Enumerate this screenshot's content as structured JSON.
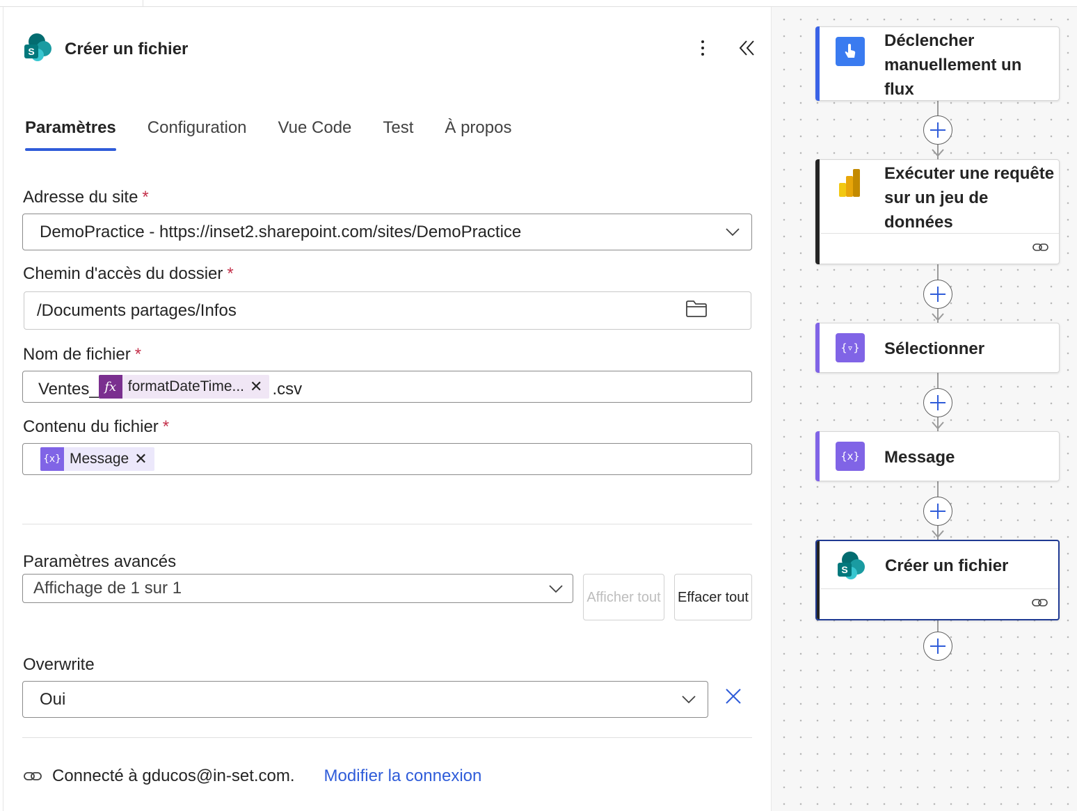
{
  "panel": {
    "title": "Créer un fichier",
    "tabs": [
      {
        "label": "Paramètres",
        "active": true
      },
      {
        "label": "Configuration"
      },
      {
        "label": "Vue Code"
      },
      {
        "label": "Test"
      },
      {
        "label": "À propos"
      }
    ],
    "site_address": {
      "label": "Adresse du site",
      "required": "*",
      "value": "DemoPractice - https://inset2.sharepoint.com/sites/DemoPractice"
    },
    "folder_path": {
      "label": "Chemin d'accès du dossier",
      "required": "*",
      "value": "/Documents partages/Infos"
    },
    "file_name": {
      "label": "Nom de fichier",
      "required": "*",
      "prefix": "Ventes_",
      "token": "formatDateTime...",
      "token_icon": "fx",
      "suffix": ".csv"
    },
    "file_content": {
      "label": "Contenu du fichier",
      "required": "*",
      "token": "Message"
    },
    "advanced": {
      "label": "Paramètres avancés",
      "value": "Affichage de 1 sur 1",
      "show_all": "Afficher tout",
      "clear_all": "Effacer tout"
    },
    "overwrite": {
      "label": "Overwrite",
      "value": "Oui"
    },
    "connection": {
      "text": "Connecté à gducos@in-set.com.",
      "change_link": "Modifier la connexion"
    }
  },
  "flow": {
    "nodes": [
      {
        "title": "Déclencher manuellement un flux",
        "icon": "hand-touch-icon",
        "color": "#3a7bf0"
      },
      {
        "title": "Exécuter une requête sur un jeu de données",
        "icon": "powerbi-icon",
        "color": "#f2c811"
      },
      {
        "title": "Sélectionner",
        "icon": "data-operation-icon",
        "color": "#8064e6"
      },
      {
        "title": "Message",
        "icon": "variable-icon",
        "color": "#8064e6"
      },
      {
        "title": "Créer un fichier",
        "icon": "sharepoint-icon",
        "color": "#038387"
      }
    ]
  },
  "colors": {
    "accent": "#2f5cd9",
    "required": "#c4314b",
    "token_fx": "#7a2f8f",
    "token_var": "#8064e6",
    "selected_border": "#1f3a93"
  }
}
